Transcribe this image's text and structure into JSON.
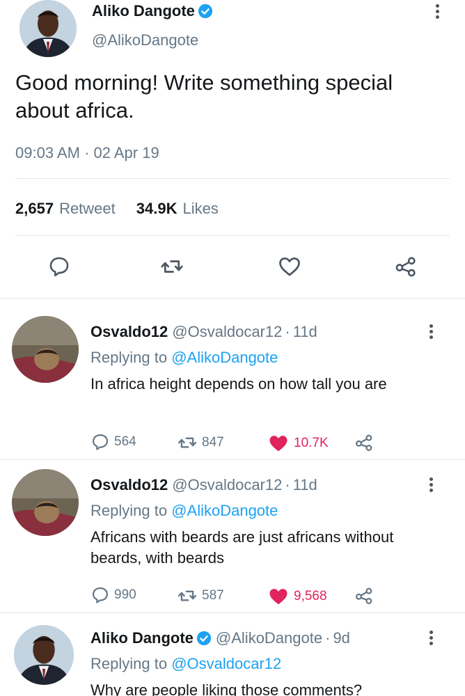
{
  "main_tweet": {
    "author_name": "Aliko Dangote",
    "author_handle": "@AlikoDangote",
    "verified": true,
    "text": "Good morning! Write something special about africa.",
    "time": "09:03 AM",
    "date_sep": " · ",
    "date": "02 Apr 19",
    "retweets_count": "2,657",
    "retweets_label": "Retweet",
    "likes_count": "34.9K",
    "likes_label": "Likes",
    "actions": [
      "reply-icon",
      "retweet-icon",
      "heart-icon",
      "share-icon"
    ]
  },
  "replies": [
    {
      "author_name": "Osvaldo12",
      "author_handle": "@Osvaldocar12",
      "age": "11d",
      "replying_prefix": "Replying to ",
      "replying_to": "@AlikoDangote",
      "text": "In africa height depends on how tall you are",
      "replies_count": "564",
      "retweets_count": "847",
      "likes_count": "10.7K",
      "liked": true
    },
    {
      "author_name": "Osvaldo12",
      "author_handle": "@Osvaldocar12",
      "age": "11d",
      "replying_prefix": "Replying to ",
      "replying_to": "@AlikoDangote",
      "text": "Africans with beards are just africans without beards, with beards",
      "replies_count": "990",
      "retweets_count": "587",
      "likes_count": "9,568",
      "liked": true
    },
    {
      "author_name": "Aliko Dangote",
      "author_handle": "@AlikoDangote",
      "age": "9d",
      "verified": true,
      "replying_prefix": "Replying to ",
      "replying_to": "@Osvaldocar12",
      "text": "Why are people liking those comments?"
    }
  ],
  "colors": {
    "accent": "#1da1f2",
    "muted": "#657786",
    "like": "#e0245e",
    "text": "#14171a",
    "divider": "#e1e8ed"
  }
}
